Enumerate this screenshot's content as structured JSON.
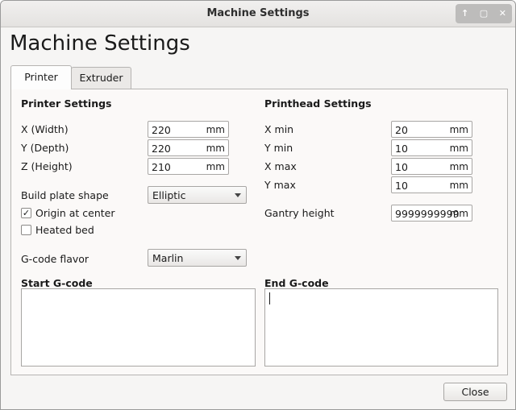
{
  "window": {
    "title": "Machine Settings",
    "controls": {
      "minimize": "↑",
      "maximize": "▢",
      "close": "✕"
    }
  },
  "heading": "Machine Settings",
  "tabs": [
    {
      "label": "Printer",
      "active": true
    },
    {
      "label": "Extruder",
      "active": false
    }
  ],
  "printer_settings": {
    "title": "Printer Settings",
    "x_width": {
      "label": "X (Width)",
      "value": "220",
      "unit": "mm"
    },
    "y_depth": {
      "label": "Y (Depth)",
      "value": "220",
      "unit": "mm"
    },
    "z_height": {
      "label": "Z (Height)",
      "value": "210",
      "unit": "mm"
    },
    "build_plate": {
      "label": "Build plate shape",
      "value": "Elliptic"
    },
    "origin_center": {
      "label": "Origin at center",
      "checked": true,
      "mark": "✓"
    },
    "heated_bed": {
      "label": "Heated bed",
      "checked": false,
      "mark": ""
    },
    "gcode_flavor": {
      "label": "G-code flavor",
      "value": "Marlin"
    }
  },
  "printhead_settings": {
    "title": "Printhead Settings",
    "x_min": {
      "label": "X min",
      "value": "20",
      "unit": "mm"
    },
    "y_min": {
      "label": "Y min",
      "value": "10",
      "unit": "mm"
    },
    "x_max": {
      "label": "X max",
      "value": "10",
      "unit": "mm"
    },
    "y_max": {
      "label": "Y max",
      "value": "10",
      "unit": "mm"
    },
    "gantry_height": {
      "label": "Gantry height",
      "value": "9999999999",
      "unit": "mm"
    }
  },
  "start_gcode": {
    "title": "Start G-code",
    "value": ""
  },
  "end_gcode": {
    "title": "End G-code",
    "value": ""
  },
  "close_button": "Close"
}
